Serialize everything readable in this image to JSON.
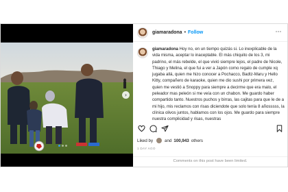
{
  "post": {
    "username": "giamaradona",
    "header_separator": "•",
    "follow_label": "Follow",
    "more_icon": "⋯",
    "caption_text": " Hoy no, en un tiempo quizás si. Lo inexplicable de la vida misma, aceptar lo inaceptable. El más chiquito de los 3, mi padrino, el más rebelde, el que vivió siempre lejos, el padre de Nicole, Thiago y Melina, el que fui a ver a Japón como regalo de cumple xq jugaba allá, quien me hizo conocer a Pochacco, Badtz-Maru y Hello Kitty, compañero de karaoke, quien me dio sushi por primera vez, quien me vestió a Snoppy para siempre a decirme que era malo, el peleador mas peleón si me veía con un chabon. Me guardo haber compartido tanto. Nuestros puchos y birras, las cajitas para que le de a mi hijo, mis reclamos con risas diciendote que solo tenía 8 añosssss, la clínica olivos juntos, hablamos con los ojos. Me guardo para siempre nuestra complicidad y risas, nuestras",
    "carousel_arrow": "›",
    "liked_by_label": "Liked by",
    "and_label": "and",
    "likes_count": "100,943",
    "others_label": "others",
    "time_ago": "1 DAY AGO",
    "comments_note": "Comments on this post have been limited.",
    "icons": {
      "like": "heart-icon",
      "comment": "comment-icon",
      "share": "share-icon",
      "save": "bookmark-icon"
    },
    "accent_color": "#0095f6"
  }
}
